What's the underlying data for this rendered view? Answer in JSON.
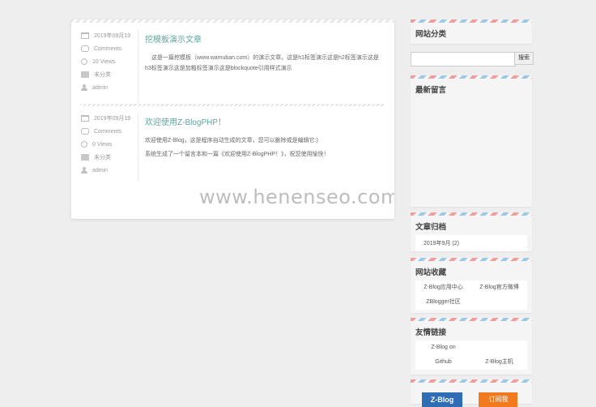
{
  "posts": [
    {
      "date": "2019年09月19",
      "comments": "Comments",
      "views": "10 Views",
      "category": "未分类",
      "author": "admin",
      "title": "挖模板演示文章",
      "paragraphs": [
        "这是一篇挖模板（www.wamuban.com）的演示文章。这是h1标签演示这是h2标签演示这是h3标签演示这是加粗标签演示这是blockquote引用样式演示"
      ]
    },
    {
      "date": "2019年09月19",
      "comments": "Comments",
      "views": "0 Views",
      "category": "未分类",
      "author": "admin",
      "title": "欢迎使用Z-BlogPHP！",
      "paragraphs": [
        "欢迎使用Z-Blog，这是程序自动生成的文章，您可以删除或是编辑它:)",
        "系统生成了一个留言本和一篇《欢迎使用Z-BlogPHP！》，祝您使用愉快！"
      ]
    }
  ],
  "watermark": "www.henenseo.com",
  "sidebar": {
    "categories_title": "网站分类",
    "search_placeholder": "",
    "search_button": "搜索",
    "recent_comments_title": "最新留言",
    "archives_title": "文章归档",
    "archive_item": "2019年9月 (2)",
    "favorites_title": "网站收藏",
    "favorites": [
      "Z-Blog应用中心",
      "Z-Blog官方微博",
      "ZBlogger社区"
    ],
    "links_title": "友情链接",
    "links": [
      "Z-Blog on",
      "Github",
      "Z-Blog主机"
    ],
    "banner_zblog": "Z-Blog",
    "banner_subscribe": "订阅我"
  },
  "colors": {
    "title_accent": "#5aa7a0",
    "airmail_red": "#ef9ea0",
    "airmail_blue": "#9ec9e6"
  }
}
